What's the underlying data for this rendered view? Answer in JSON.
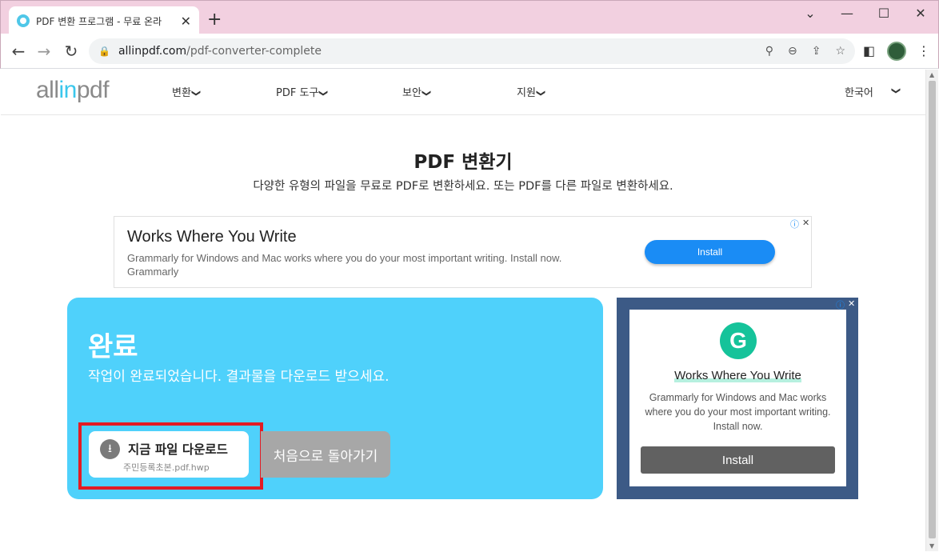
{
  "browser": {
    "tab_title": "PDF 변환 프로그램 - 무료 온라",
    "tab_close": "✕",
    "new_tab": "+",
    "window_controls": {
      "dropdown": "⌄",
      "minimize": "—",
      "maximize": "☐",
      "close": "✕"
    },
    "url_domain": "allinpdf.com",
    "url_path": "/pdf-converter-complete"
  },
  "site": {
    "logo_pre": "all",
    "logo_in": "in",
    "logo_post": "pdf",
    "nav": [
      {
        "label": "변환"
      },
      {
        "label": "PDF 도구"
      },
      {
        "label": "보안"
      },
      {
        "label": "지원"
      }
    ],
    "language": "한국어"
  },
  "hero": {
    "title": "PDF 변환기",
    "subtitle": "다양한 유형의 파일을 무료로 PDF로 변환하세요. 또는 PDF를 다른 파일로 변환하세요."
  },
  "ad_top": {
    "title": "Works Where You Write",
    "body": "Grammarly for Windows and Mac works where you do your most important writing. Install now.",
    "advertiser": "Grammarly",
    "install": "Install"
  },
  "result": {
    "title": "완료",
    "subtitle": "작업이 완료되었습니다. 결과물을 다운로드 받으세요.",
    "download_label": "지금 파일 다운로드",
    "file_name": "주민등록초본.pdf.hwp",
    "back_label": "처음으로 돌아가기"
  },
  "ad_side": {
    "logo_letter": "G",
    "title": "Works Where You Write",
    "body": "Grammarly for Windows and Mac works where you do your most important writing. Install now.",
    "install": "Install"
  }
}
